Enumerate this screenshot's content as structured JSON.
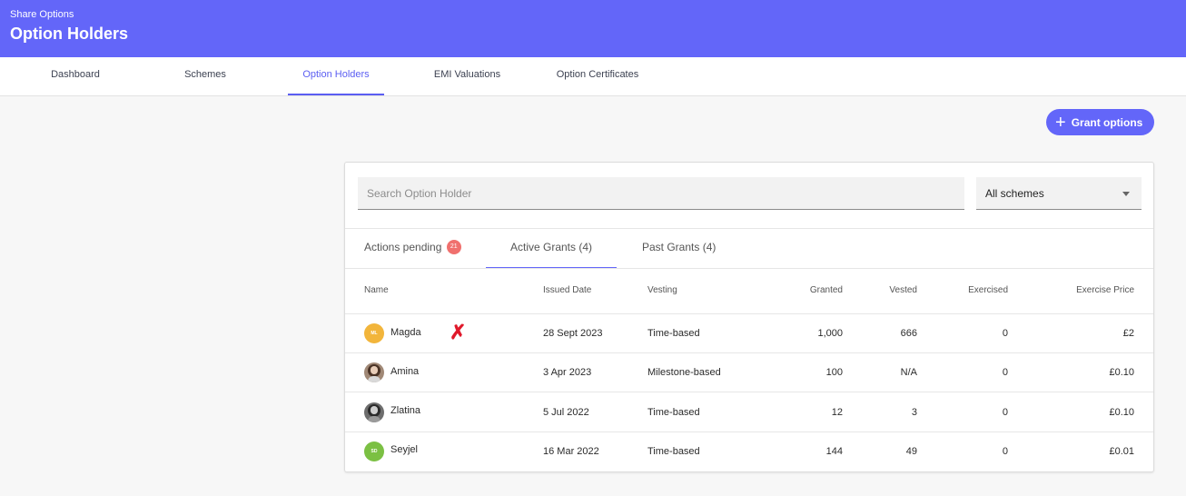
{
  "header": {
    "section": "Share Options",
    "title": "Option Holders"
  },
  "nav": {
    "tabs": [
      {
        "label": "Dashboard"
      },
      {
        "label": "Schemes"
      },
      {
        "label": "Option Holders"
      },
      {
        "label": "EMI Valuations"
      },
      {
        "label": "Option Certificates"
      }
    ],
    "active": "Option Holders"
  },
  "grant_button": {
    "label": "Grant options",
    "icon": "plus-icon"
  },
  "search": {
    "placeholder": "Search Option Holder",
    "value": ""
  },
  "scheme_filter": {
    "selected": "All schemes"
  },
  "grant_tabs": {
    "actions_pending": {
      "label": "Actions pending",
      "count": "21"
    },
    "active": {
      "label": "Active Grants (4)"
    },
    "past": {
      "label": "Past Grants (4)"
    }
  },
  "table": {
    "columns": [
      "Name",
      "Issued Date",
      "Vesting",
      "Granted",
      "Vested",
      "Exercised",
      "Exercise Price"
    ],
    "rows": [
      {
        "initials": "ML",
        "name": "Magda",
        "issued": "28 Sept 2023",
        "vesting": "Time-based",
        "granted": "1,000",
        "vested": "666",
        "exercised": "0",
        "price": "£2",
        "avatar_color": "#f2b53b"
      },
      {
        "initials": "",
        "name": "Amina",
        "issued": "3 Apr 2023",
        "vesting": "Milestone-based",
        "granted": "100",
        "vested": "N/A",
        "exercised": "0",
        "price": "£0.10",
        "avatar_color": "#a08876"
      },
      {
        "initials": "",
        "name": "Zlatina",
        "issued": "5 Jul 2022",
        "vesting": "Time-based",
        "granted": "12",
        "vested": "3",
        "exercised": "0",
        "price": "£0.10",
        "avatar_color": "#6d6d6d"
      },
      {
        "initials": "SD",
        "name": "Seyjel",
        "issued": "16 Mar 2022",
        "vesting": "Time-based",
        "granted": "144",
        "vested": "49",
        "exercised": "0",
        "price": "£0.01",
        "avatar_color": "#7bc043"
      }
    ]
  },
  "colors": {
    "brand": "#6366f9",
    "badge": "#f0706e",
    "delete_mark": "#e0192b"
  }
}
